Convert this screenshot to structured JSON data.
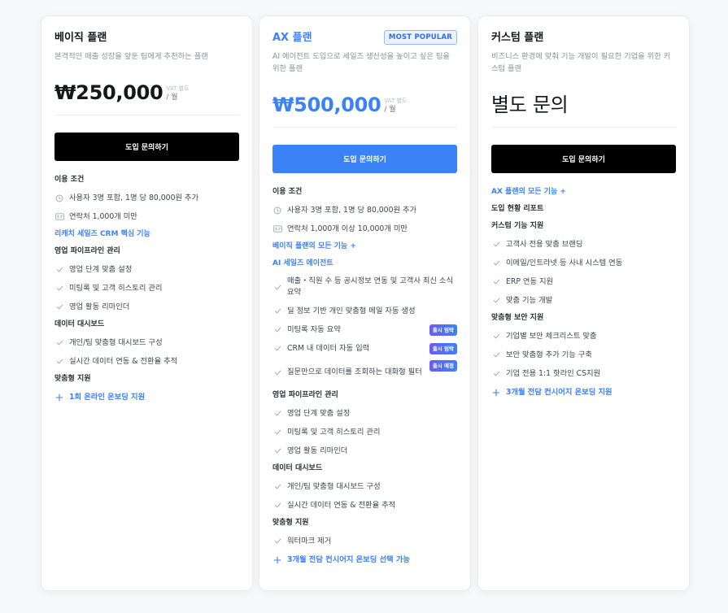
{
  "colors": {
    "accent": "#3b82f6",
    "badge": "#6b5cf6",
    "cta_dark": "#000000"
  },
  "plans": [
    {
      "name": "베이직 플랜",
      "description": "본격적인 매출 성장을 앞둔 팀에게 추천하는 플랜",
      "price": "₩250,000",
      "vat": "VAT 별도",
      "per": "/ 월",
      "cta": "도입 문의하기",
      "sections": [
        {
          "title": "이용 조건",
          "items": [
            {
              "icon": "clock-icon",
              "text": "사용자 3명 포함, 1명 당 80,000원 추가"
            },
            {
              "icon": "contact-card-icon",
              "text": "연락처 1,000개 미만"
            }
          ]
        },
        {
          "title": "리캐치 세일즈 CRM 핵심 기능",
          "link": true,
          "items": []
        },
        {
          "title": "영업 파이프라인 관리",
          "items": [
            {
              "icon": "check-icon",
              "text": "영업 단계 맞춤 설정"
            },
            {
              "icon": "check-icon",
              "text": "미팅록 및 고객 히스토리 관리"
            },
            {
              "icon": "check-icon",
              "text": "영업 활동 리마인더"
            }
          ]
        },
        {
          "title": "데이터 대시보드",
          "items": [
            {
              "icon": "check-icon",
              "text": "개인/팀 맞춤형 대시보드 구성"
            },
            {
              "icon": "check-icon",
              "text": "실시간 데이터 연동 & 전환율 추적"
            }
          ]
        },
        {
          "title": "맞춤형 지원",
          "items": [
            {
              "icon": "plus-icon",
              "text": "1회 온라인 온보딩 지원"
            }
          ]
        }
      ]
    },
    {
      "name": "AX 플랜",
      "badge": "MOST POPULAR",
      "description": "AI 에이전트 도입으로 세일즈 생산성을 높이고 싶은 팀을 위한 플랜",
      "price": "₩500,000",
      "vat": "VAT 별도",
      "per": "/ 월",
      "cta": "도입 문의하기",
      "sections": [
        {
          "title": "이용 조건",
          "items": [
            {
              "icon": "clock-icon",
              "text": "사용자 3명 포함, 1명 당 80,000원 추가"
            },
            {
              "icon": "contact-card-icon",
              "text": "연락처 1,000개 이상 10,000개 미만"
            }
          ]
        },
        {
          "title": "베이직 플랜의 모든 기능 +",
          "link": true,
          "items": []
        },
        {
          "title": "AI 세일즈 에이전트",
          "link": true,
          "items": [
            {
              "icon": "check-icon",
              "text": "매출・직원 수 등 공시정보 연동 및 고객사 최신 소식 요약",
              "tall": true
            },
            {
              "icon": "check-icon",
              "text": "딜 정보 기반 개인 맞춤형 메일 자동 생성"
            },
            {
              "icon": "check-icon",
              "text": "미팅록 자동 요약",
              "badge": "출시 임박"
            },
            {
              "icon": "check-icon",
              "text": "CRM 내 데이터 자동 입력",
              "badge": "출시 임박"
            },
            {
              "icon": "check-icon",
              "text": "질문만으로 데이터를 조회하는 대화형 필터",
              "badge": "출시 예정",
              "tall": true
            }
          ]
        },
        {
          "title": "영업 파이프라인 관리",
          "items": [
            {
              "icon": "check-icon",
              "text": "영업 단계 맞춤 설정"
            },
            {
              "icon": "check-icon",
              "text": "미팅록 및 고객 히스토리 관리"
            },
            {
              "icon": "check-icon",
              "text": "영업 활동 리마인더"
            }
          ]
        },
        {
          "title": "데이터 대시보드",
          "items": [
            {
              "icon": "check-icon",
              "text": "개인/팀 맞춤형 대시보드 구성"
            },
            {
              "icon": "check-icon",
              "text": "실시간 데이터 연동 & 전환율 추적"
            }
          ]
        },
        {
          "title": "맞춤형 지원",
          "items": [
            {
              "icon": "check-icon",
              "text": "워터마크 제거"
            },
            {
              "icon": "plus-icon",
              "text": "3개월 전담 컨시어지 온보딩 선택 가능"
            }
          ]
        }
      ]
    },
    {
      "name": "커스텀 플랜",
      "description": "비즈니스 환경에 맞춰 기능 개발이 필요한 기업을 위한 커스텀 플랜",
      "price": "별도 문의",
      "cta": "도입 문의하기",
      "sections": [
        {
          "title": "AX 플랜의 모든 기능 +",
          "link": true,
          "items": []
        },
        {
          "title": "도입 현황 리포트",
          "items": []
        },
        {
          "title": "커스텀 기능 지원",
          "items": [
            {
              "icon": "check-icon",
              "text": "고객사 전용 맞춤 브랜딩"
            },
            {
              "icon": "check-icon",
              "text": "이메일/인트라넷 등 사내 시스템 연동"
            },
            {
              "icon": "check-icon",
              "text": "ERP 연동 지원"
            },
            {
              "icon": "check-icon",
              "text": "맞춤 기능 개발"
            }
          ]
        },
        {
          "title": "맞춤형 보안 지원",
          "items": [
            {
              "icon": "check-icon",
              "text": "기업별 보안 체크리스트 맞춤"
            },
            {
              "icon": "check-icon",
              "text": "보안 맞춤형 추가 기능 구축"
            },
            {
              "icon": "check-icon",
              "text": "기업 전용 1:1 핫라인 CS지원"
            },
            {
              "icon": "plus-icon",
              "text": "3개월 전담 컨시어지 온보딩 지원"
            }
          ]
        }
      ]
    }
  ]
}
